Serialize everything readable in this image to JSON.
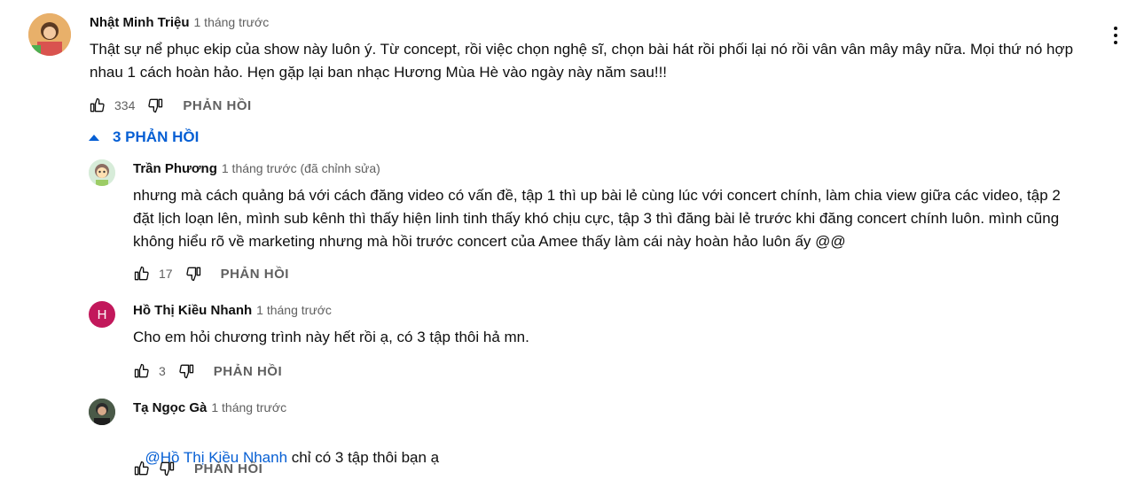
{
  "comment": {
    "author": "Nhật Minh Triệu",
    "time": "1 tháng trước",
    "text_line1": "Thật sự nể phục ekip của show này luôn ý. Từ concept, rồi việc chọn nghệ sĩ, chọn bài hát rồi phối lại nó rồi vân vân mây mây nữa. Mọi thứ nó hợp",
    "text_line2": "nhau 1 cách hoàn hảo. Hẹn gặp lại ban nhạc Hương Mùa Hè vào ngày này năm sau!!!",
    "likes": "334",
    "reply_label": "PHẢN HỒI"
  },
  "replies_toggle": {
    "label": "3 PHẢN HỒI",
    "icon": "caret-up-icon"
  },
  "replies": [
    {
      "author": "Trần Phương",
      "time": "1 tháng trước (đã chỉnh sửa)",
      "lines": [
        "nhưng mà cách quảng bá với cách đăng video có vấn đề, tập 1 thì up bài lẻ cùng lúc với concert chính, làm chia view giữa các video, tập 2",
        "đặt lịch loạn lên, mình sub kênh thì thấy hiện linh tinh thấy khó chịu cực, tập 3 thì đăng bài lẻ trước khi đăng concert chính luôn. mình cũng",
        "không hiểu rõ về marketing nhưng mà hồi trước concert của Amee thấy làm cái này hoàn hảo luôn ấy @@"
      ],
      "likes": "17",
      "reply_label": "PHẢN HỒI"
    },
    {
      "author": "Hồ Thị Kiều Nhanh",
      "time": "1 tháng trước",
      "avatar_letter": "H",
      "text": "Cho em hỏi chương trình này hết rồi ạ, có 3 tập thôi hả mn.",
      "likes": "3",
      "reply_label": "PHẢN HỒI"
    },
    {
      "author": "Tạ Ngọc Gà",
      "time": "1 tháng trước",
      "mention": "@Hồ Thị Kiều Nhanh",
      "text": " chỉ có 3 tập thôi bạn ạ",
      "reply_label": "PHẢN HỒI"
    }
  ],
  "colors": {
    "link": "#065fd4",
    "muted": "#606060",
    "avatar_h": "#c2185b"
  }
}
